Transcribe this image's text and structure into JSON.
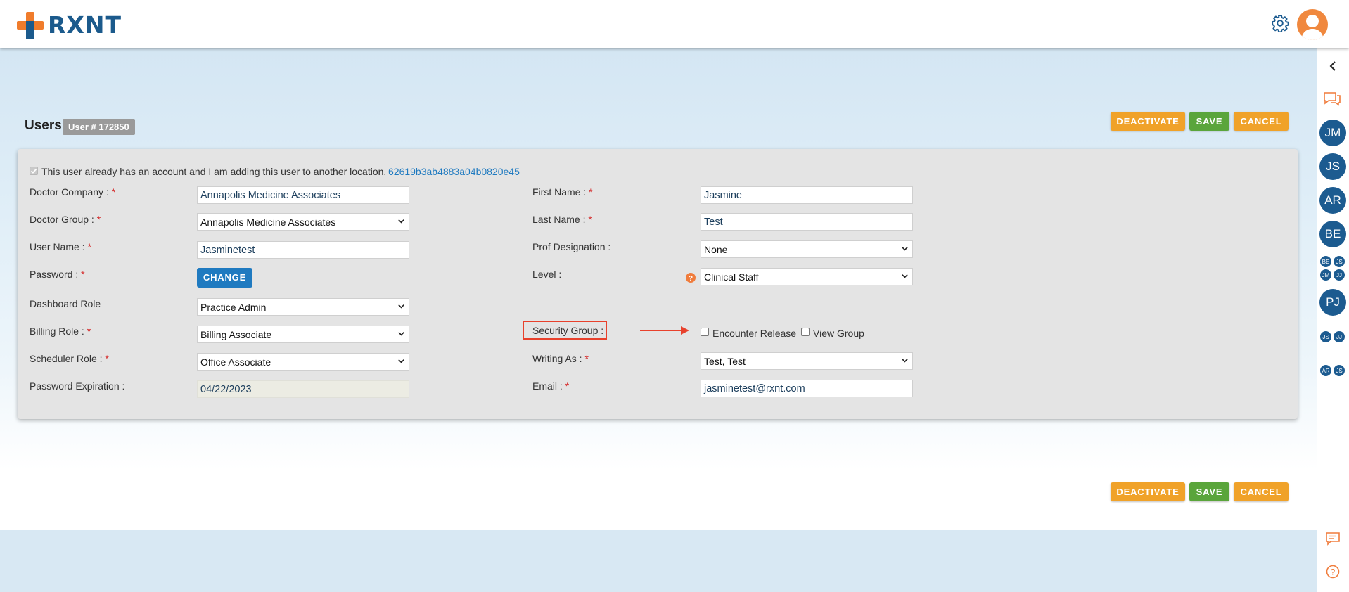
{
  "brand": {
    "name": "RXNT"
  },
  "page": {
    "title": "Users",
    "user_badge": "User # 172850"
  },
  "actions": {
    "deactivate": "DEACTIVATE",
    "save": "SAVE",
    "cancel": "CANCEL"
  },
  "form": {
    "existing_account_text": "This user already has an account and I am adding this user to another location.",
    "existing_account_id": "62619b3ab4883a04b0820e45",
    "change_label": "CHANGE",
    "left": {
      "doctor_company": {
        "label": "Doctor Company :",
        "value": "Annapolis Medicine Associates"
      },
      "doctor_group": {
        "label": "Doctor Group :",
        "value": "Annapolis Medicine Associates"
      },
      "user_name": {
        "label": "User Name :",
        "value": "Jasminetest"
      },
      "password": {
        "label": "Password :"
      },
      "dashboard_role": {
        "label": "Dashboard Role",
        "value": "Practice Admin"
      },
      "billing_role": {
        "label": "Billing Role :",
        "value": "Billing Associate"
      },
      "scheduler_role": {
        "label": "Scheduler Role :",
        "value": "Office Associate"
      },
      "password_expiration": {
        "label": "Password Expiration :",
        "value": "04/22/2023"
      }
    },
    "right": {
      "first_name": {
        "label": "First Name :",
        "value": "Jasmine"
      },
      "last_name": {
        "label": "Last Name :",
        "value": "Test"
      },
      "prof_designation": {
        "label": "Prof Designation :",
        "value": "None"
      },
      "level": {
        "label": "Level :",
        "value": "Clinical Staff"
      },
      "security_group": {
        "label": "Security Group :",
        "options": [
          "Encounter Release",
          "View Group"
        ]
      },
      "writing_as": {
        "label": "Writing As :",
        "value": "Test, Test"
      },
      "email": {
        "label": "Email :",
        "value": "jasminetest@rxnt.com"
      }
    },
    "required_mark": "*"
  },
  "rail": {
    "users": [
      "JM",
      "JS",
      "AR",
      "BE"
    ],
    "group1": [
      "BE",
      "JS",
      "JM",
      "JJ"
    ],
    "single": "PJ",
    "group2": [
      "JS",
      "JJ"
    ],
    "group3": [
      "AR",
      "JS"
    ]
  },
  "colors": {
    "accent_blue": "#1c5b90",
    "orange": "#f0a229",
    "green": "#5aa53b",
    "annotation_red": "#e8412c"
  }
}
